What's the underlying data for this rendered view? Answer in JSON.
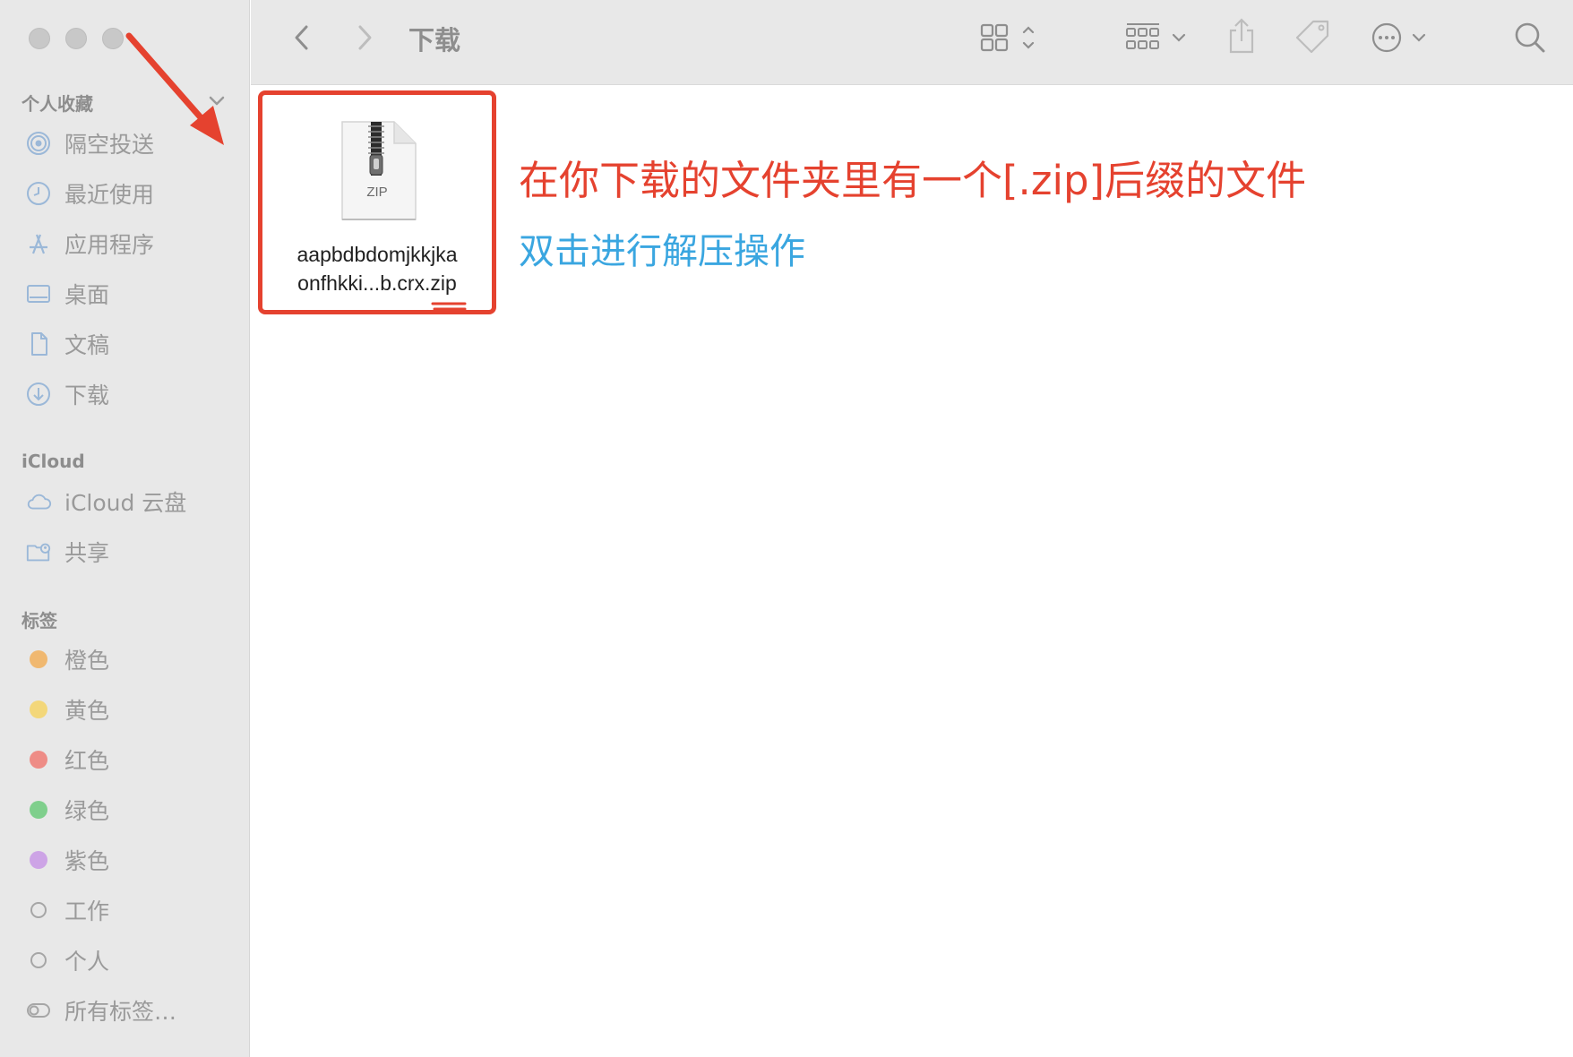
{
  "window": {
    "title": "下载"
  },
  "sidebar": {
    "favorites_title": "个人收藏",
    "favorites": [
      {
        "label": "隔空投送",
        "icon": "airdrop-icon"
      },
      {
        "label": "最近使用",
        "icon": "clock-icon"
      },
      {
        "label": "应用程序",
        "icon": "applications-icon"
      },
      {
        "label": "桌面",
        "icon": "desktop-icon"
      },
      {
        "label": "文稿",
        "icon": "document-icon"
      },
      {
        "label": "下载",
        "icon": "download-icon"
      }
    ],
    "icloud_title": "iCloud",
    "icloud": [
      {
        "label": "iCloud 云盘",
        "icon": "cloud-icon"
      },
      {
        "label": "共享",
        "icon": "shared-folder-icon"
      }
    ],
    "tags_title": "标签",
    "tags": [
      {
        "label": "橙色",
        "color": "#f0b870"
      },
      {
        "label": "黄色",
        "color": "#f3d77a"
      },
      {
        "label": "红色",
        "color": "#ee8c86"
      },
      {
        "label": "绿色",
        "color": "#7fcf8c"
      },
      {
        "label": "紫色",
        "color": "#cda4e6"
      },
      {
        "label": "工作",
        "color": ""
      },
      {
        "label": "个人",
        "color": ""
      },
      {
        "label": "所有标签…",
        "color": ""
      }
    ]
  },
  "files": [
    {
      "name_line1": "aapbdbdomjkkjka",
      "name_line2": "onfhkki...b.crx.zip",
      "badge": "ZIP"
    }
  ],
  "annotations": {
    "main": "在你下载的文件夹里有一个[.zip]后缀的文件",
    "sub": "双击进行解压操作"
  },
  "colors": {
    "annotation_red": "#e5422f",
    "annotation_blue": "#3aa6e0"
  }
}
